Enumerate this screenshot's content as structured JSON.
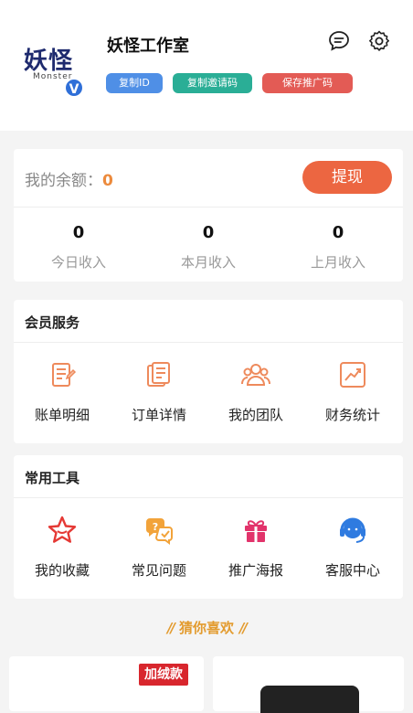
{
  "profile": {
    "logo_cn": "妖怪",
    "logo_en": "Monster",
    "badge": "V",
    "name": "妖怪工作室",
    "buttons": [
      "复制ID",
      "复制邀请码",
      "保存推广码"
    ]
  },
  "balance": {
    "label": "我的余额：",
    "value": "0",
    "withdraw_label": "提现",
    "stats": [
      {
        "value": "0",
        "label": "今日收入"
      },
      {
        "value": "0",
        "label": "本月收入"
      },
      {
        "value": "0",
        "label": "上月收入"
      }
    ]
  },
  "member_services": {
    "title": "会员服务",
    "items": [
      {
        "label": "账单明细",
        "icon": "bill-icon"
      },
      {
        "label": "订单详情",
        "icon": "order-icon"
      },
      {
        "label": "我的团队",
        "icon": "team-icon"
      },
      {
        "label": "财务统计",
        "icon": "chart-icon"
      }
    ]
  },
  "tools": {
    "title": "常用工具",
    "items": [
      {
        "label": "我的收藏",
        "icon": "star-icon"
      },
      {
        "label": "常见问题",
        "icon": "faq-icon"
      },
      {
        "label": "推广海报",
        "icon": "gift-icon"
      },
      {
        "label": "客服中心",
        "icon": "headset-icon"
      }
    ]
  },
  "guess": {
    "title": "猜你喜欢",
    "product_tag": "加绒款"
  },
  "colors": {
    "accent": "#ec6641",
    "member_icon": "#ee8a5c",
    "star": "#e53935",
    "faq": "#f2a33a",
    "gift": "#e2336b",
    "headset": "#2f7be0"
  }
}
